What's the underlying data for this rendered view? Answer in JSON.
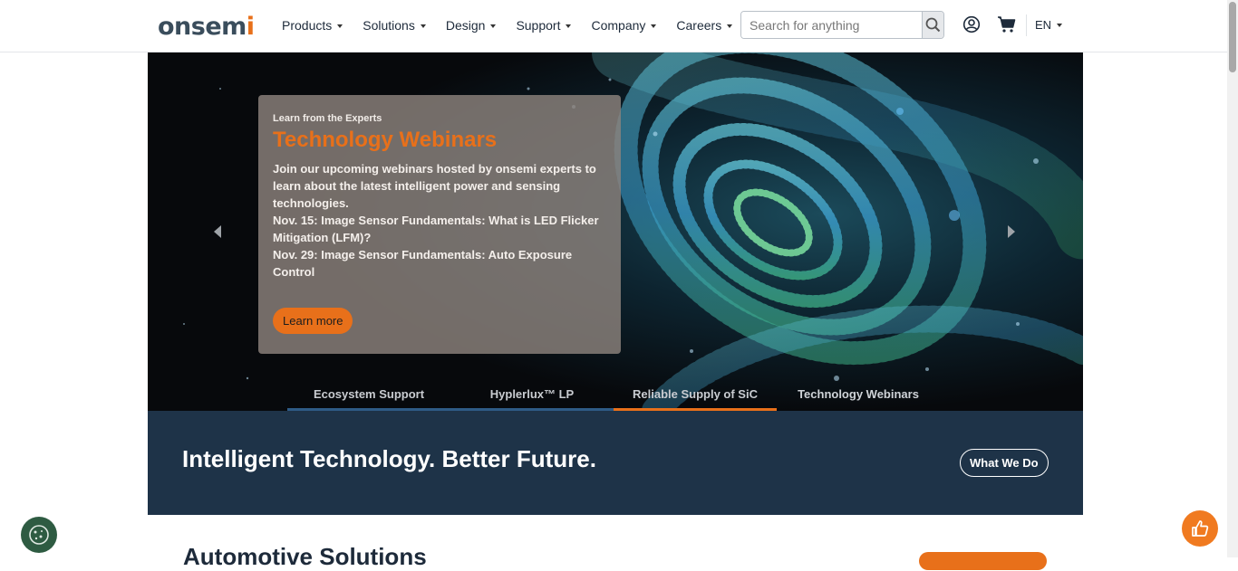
{
  "header": {
    "logo_text": "onsem",
    "logo_accent": "i",
    "nav": [
      {
        "label": "Products"
      },
      {
        "label": "Solutions"
      },
      {
        "label": "Design"
      },
      {
        "label": "Support"
      },
      {
        "label": "Company"
      },
      {
        "label": "Careers"
      }
    ],
    "search_placeholder": "Search for anything",
    "lang": "EN",
    "icons": {
      "search": "search-icon",
      "account": "user-circle-icon",
      "cart": "cart-icon"
    }
  },
  "hero": {
    "eyebrow": "Learn from the Experts",
    "title": "Technology Webinars",
    "description": "Join our upcoming webinars hosted by onsemi experts to learn about the latest intelligent power and sensing technologies.",
    "line1": "Nov. 15: Image Sensor Fundamentals: What is LED Flicker Mitigation (LFM)?",
    "line2": "Nov. 29: Image Sensor Fundamentals: Auto Exposure Control",
    "cta": "Learn more",
    "tabs": [
      {
        "label": "Ecosystem Support"
      },
      {
        "label": "Hyplerlux™ LP"
      },
      {
        "label": "Reliable Supply of SiC"
      },
      {
        "label": "Technology Webinars"
      }
    ],
    "active_tab": "Reliable Supply of SiC"
  },
  "banner": {
    "title": "Intelligent Technology. Better Future.",
    "button": "What We Do"
  },
  "section": {
    "title": "Automotive Solutions"
  },
  "colors": {
    "accent": "#e8701a",
    "banner": "#1e3348",
    "cookie": "#2e5b42"
  }
}
